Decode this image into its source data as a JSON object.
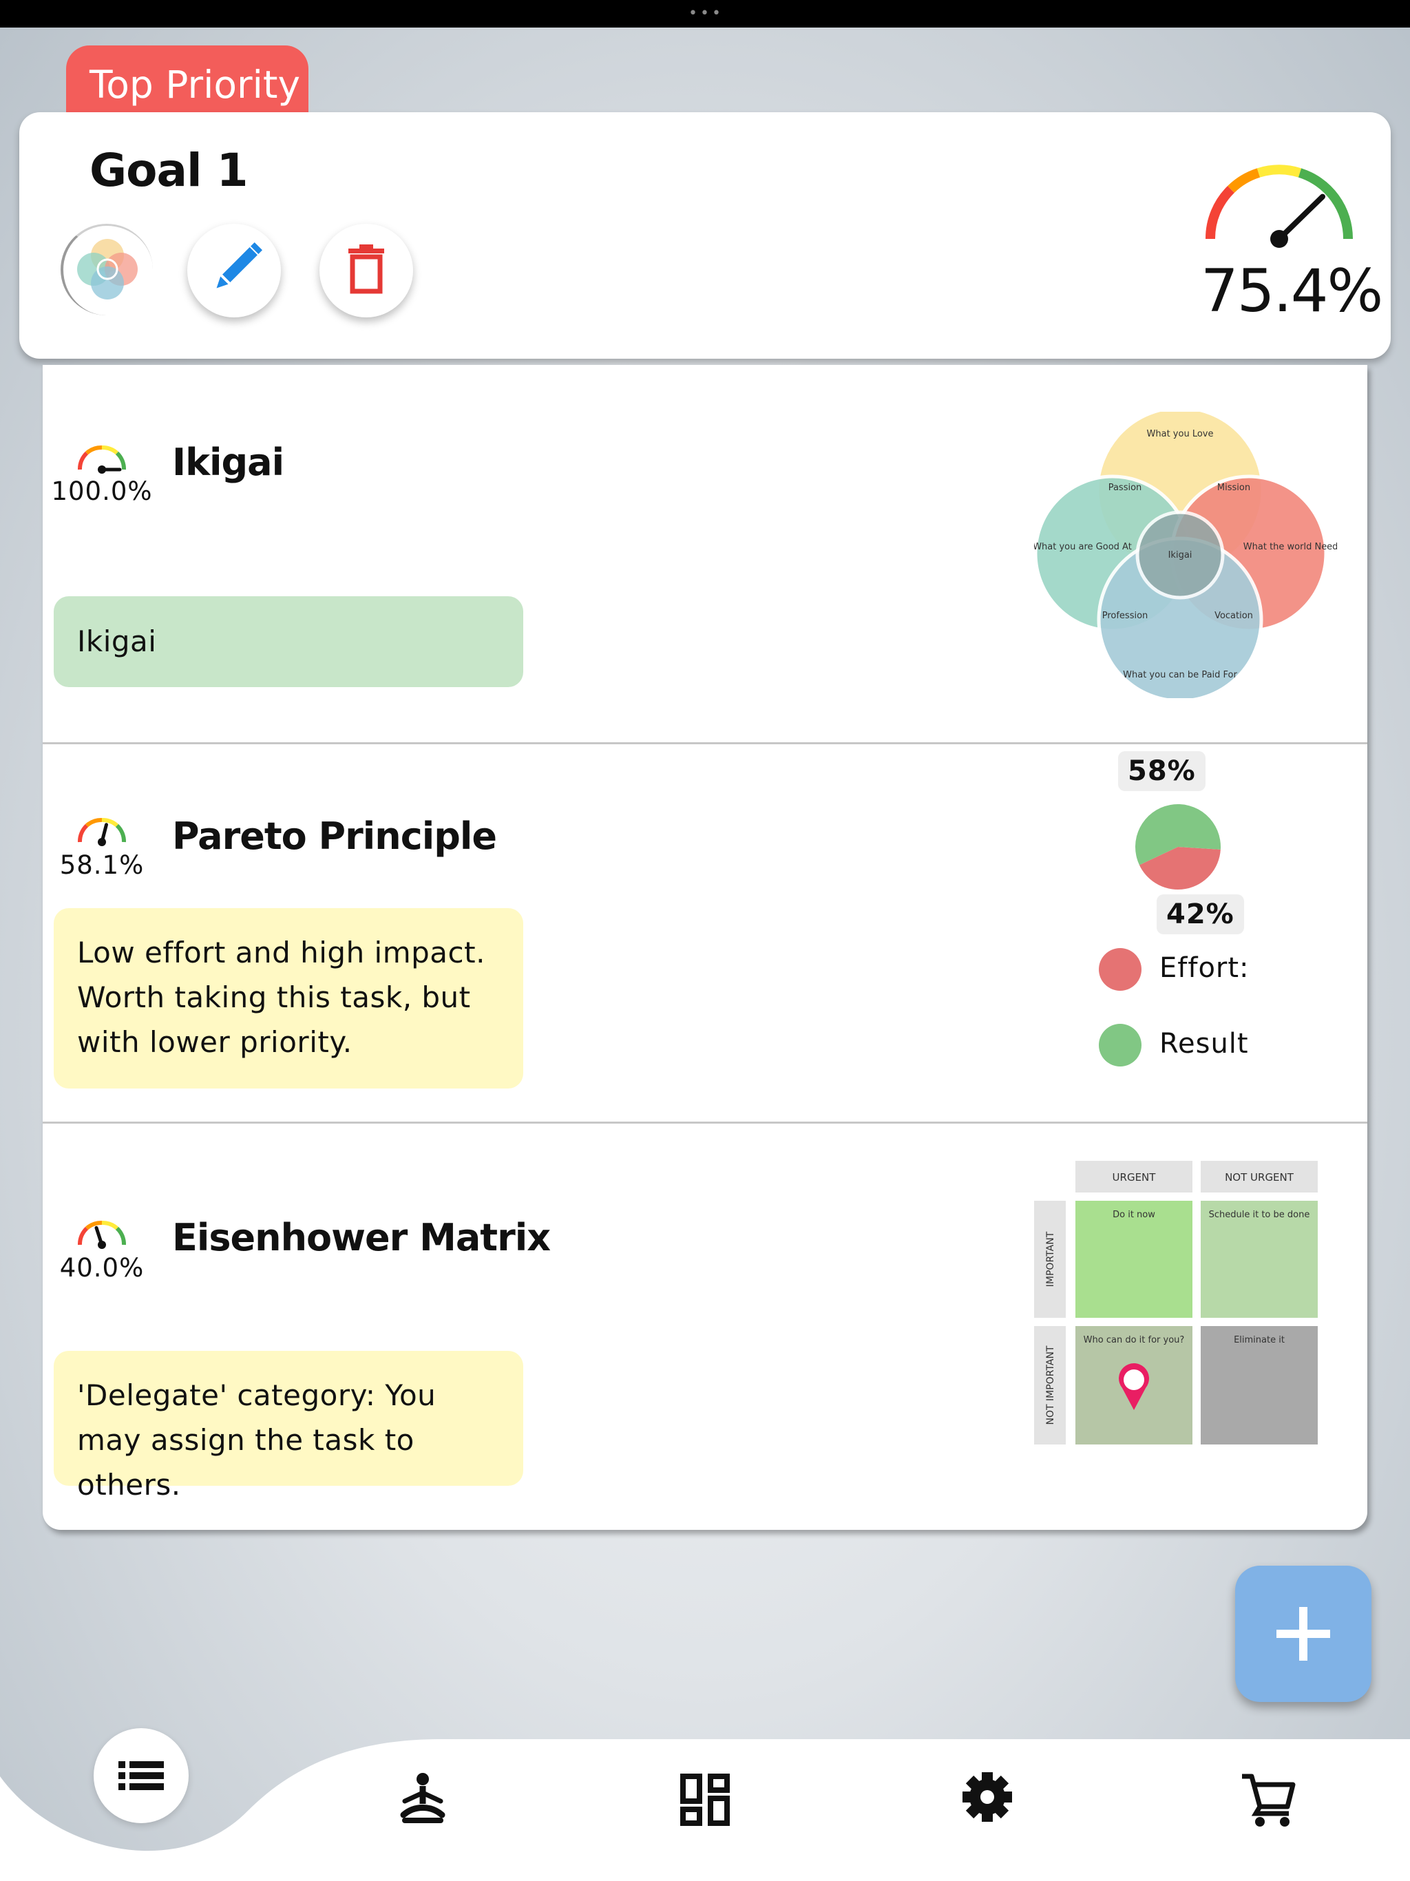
{
  "header": {
    "priority_tag": "Top Priority",
    "goal_title": "Goal 1",
    "goal_progress_label": "75.4%",
    "goal_progress": 0.754
  },
  "items": [
    {
      "title": "Ikigai",
      "progress_label": "100.0%",
      "progress": 1.0,
      "note": "Ikigai",
      "note_color": "#c8e6c9",
      "venn": {
        "top": "What you Love",
        "left": "What you are Good At",
        "right": "What the world Needs",
        "bottom": "What you can be Paid For",
        "passion": "Passion",
        "mission": "Mission",
        "profession": "Profession",
        "vocation": "Vocation",
        "center": "Ikigai"
      }
    },
    {
      "title": "Pareto Principle",
      "progress_label": "58.1%",
      "progress": 0.581,
      "note": "Low effort and high impact. Worth taking this task, but with lower priority.",
      "note_color": "#fff9c4",
      "chart_data": {
        "type": "pie",
        "categories": [
          "Effort:",
          "Result"
        ],
        "values": [
          42,
          58
        ],
        "labels": [
          "42%",
          "58%"
        ],
        "colors": [
          "#e57373",
          "#81c784"
        ]
      }
    },
    {
      "title": "Eisenhower Matrix",
      "progress_label": "40.0%",
      "progress": 0.4,
      "note": "'Delegate' category: You may assign the task to others.",
      "note_color": "#fff9c4",
      "matrix": {
        "col_urgent": "URGENT",
        "col_not_urgent": "NOT URGENT",
        "row_important": "IMPORTANT",
        "row_not_important": "NOT IMPORTANT",
        "do": "Do it now",
        "schedule": "Schedule it to be done",
        "delegate": "Who can do it for you?",
        "eliminate": "Eliminate it",
        "selected": "delegate"
      }
    }
  ],
  "fab": {
    "icon": "plus-icon"
  },
  "nav": {
    "items": [
      "list-icon",
      "meditation-icon",
      "dashboard-icon",
      "gear-icon",
      "cart-icon"
    ],
    "active": "list-icon"
  },
  "colors": {
    "accent": "#f35d5a",
    "fab": "#80b2e6",
    "delete": "#e53935",
    "edit": "#1e88e5"
  }
}
